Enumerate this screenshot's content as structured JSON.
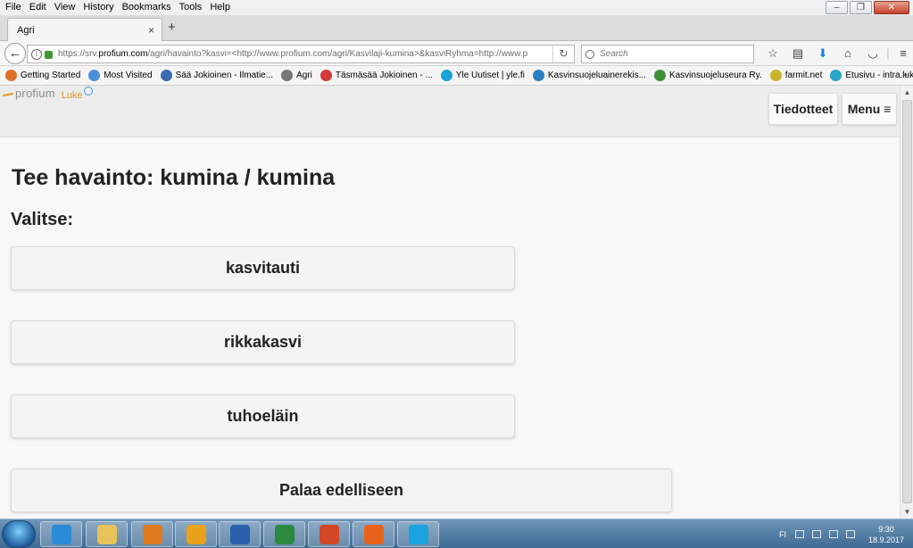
{
  "menubar": {
    "items": [
      "File",
      "Edit",
      "View",
      "History",
      "Bookmarks",
      "Tools",
      "Help"
    ]
  },
  "window_controls": [
    "minimize-icon",
    "restore-icon",
    "close-icon"
  ],
  "tab": {
    "title": "Agri",
    "close": "×",
    "new_tab": "+"
  },
  "navbar": {
    "url_prefix": "https://srv.",
    "url_domain": "profium.com",
    "url_rest": "/agri/havainto?kasvi=<http://www.profium.com/agri/Kasvilaji-kumina>&kasviRyhma=http://www.p",
    "search_placeholder": "Search"
  },
  "bookmarks": [
    {
      "label": "Getting Started",
      "color": "#e0702a"
    },
    {
      "label": "Most Visited",
      "color": "#4b8fd8"
    },
    {
      "label": "Sää Jokioinen - Ilmatie...",
      "color": "#3a6bb0"
    },
    {
      "label": "Agri",
      "color": "#777777"
    },
    {
      "label": "Täsmäsää Jokioinen - ...",
      "color": "#d23a3a"
    },
    {
      "label": "Yle Uutiset | yle.fi",
      "color": "#1aa3d6"
    },
    {
      "label": "Kasvinsuojeluainerekis...",
      "color": "#2e7fc0"
    },
    {
      "label": "Kasvinsuojeluseura Ry.",
      "color": "#3f8f3a"
    },
    {
      "label": "farmit.net",
      "color": "#c9b52a"
    },
    {
      "label": "Etusivu - intra.luke.fi",
      "color": "#2aa6c9"
    }
  ],
  "site": {
    "logo_text": "profium",
    "logo_luke": "Luke",
    "btn_tiedotteet": "Tiedotteet",
    "btn_menu": "Menu ≡"
  },
  "page": {
    "title": "Tee havainto: kumina / kumina",
    "subtitle": "Valitse:",
    "choices": [
      "kasvitauti",
      "rikkakasvi",
      "tuhoeläin"
    ],
    "back_label": "Palaa edelliseen"
  },
  "taskbar": {
    "apps": [
      {
        "name": "internet-explorer",
        "color": "#2a8ad6"
      },
      {
        "name": "file-explorer",
        "color": "#e8c35a"
      },
      {
        "name": "media-player",
        "color": "#e07a1f"
      },
      {
        "name": "outlook",
        "color": "#e8a21a"
      },
      {
        "name": "word",
        "color": "#2b5fab"
      },
      {
        "name": "excel",
        "color": "#2a8a3e"
      },
      {
        "name": "powerpoint",
        "color": "#d24726"
      },
      {
        "name": "firefox",
        "color": "#e8631a"
      },
      {
        "name": "skype",
        "color": "#1aa3e0"
      }
    ],
    "lang": "FI",
    "time": "9:30",
    "date": "18.9.2017"
  }
}
